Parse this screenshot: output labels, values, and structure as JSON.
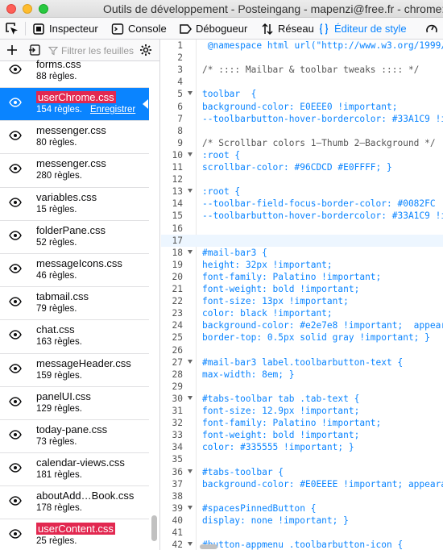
{
  "window": {
    "title": "Outils de développement - Posteingang - mapenzi@free.fr - chrome:/"
  },
  "toolbar": {
    "tabs": [
      {
        "label": "Inspecteur",
        "icon": "inspector-icon"
      },
      {
        "label": "Console",
        "icon": "console-icon"
      },
      {
        "label": "Débogueur",
        "icon": "debugger-icon"
      },
      {
        "label": "Réseau",
        "icon": "network-icon"
      },
      {
        "label": "Éditeur de style",
        "icon": "style-editor-icon",
        "selected": true
      }
    ]
  },
  "sidebar": {
    "filter_placeholder": "Filtrer les feuilles",
    "sheets": [
      {
        "name": "forms.css",
        "rules": "88 règles."
      },
      {
        "name": "userChrome.css",
        "rules": "154 règles.",
        "save": "Enregistrer",
        "selected": true,
        "highlight": true
      },
      {
        "name": "messenger.css",
        "rules": "80 règles."
      },
      {
        "name": "messenger.css",
        "rules": "280 règles."
      },
      {
        "name": "variables.css",
        "rules": "15 règles."
      },
      {
        "name": "folderPane.css",
        "rules": "52 règles."
      },
      {
        "name": "messageIcons.css",
        "rules": "46 règles."
      },
      {
        "name": "tabmail.css",
        "rules": "79 règles."
      },
      {
        "name": "chat.css",
        "rules": "163 règles."
      },
      {
        "name": "messageHeader.css",
        "rules": "159 règles."
      },
      {
        "name": "panelUI.css",
        "rules": "129 règles."
      },
      {
        "name": "today-pane.css",
        "rules": "73 règles."
      },
      {
        "name": "calendar-views.css",
        "rules": "181 règles."
      },
      {
        "name": "aboutAdd…Book.css",
        "rules": "178 règles."
      },
      {
        "name": "userContent.css",
        "rules": "25 règles.",
        "highlight": true
      }
    ]
  },
  "editor": {
    "lines": [
      {
        "n": "1",
        "t": " @namespace html url(\"http://www.w3.org/1999/"
      },
      {
        "n": "2",
        "t": ""
      },
      {
        "n": "3",
        "t": "/* :::: Mailbar & toolbar tweaks :::: */"
      },
      {
        "n": "4",
        "t": ""
      },
      {
        "n": "5",
        "t": "toolbar  {"
      },
      {
        "n": "6",
        "t": "background-color: E0EEE0 !important;"
      },
      {
        "n": "7",
        "t": "--toolbarbutton-hover-bordercolor: #33A1C9 !i"
      },
      {
        "n": "8",
        "t": ""
      },
      {
        "n": "9",
        "t": "/* Scrollbar colors 1—Thumb 2—Background */"
      },
      {
        "n": "10",
        "t": ":root {"
      },
      {
        "n": "11",
        "t": "scrollbar-color: #96CDCD #E0FFFF; }"
      },
      {
        "n": "12",
        "t": ""
      },
      {
        "n": "13",
        "t": ":root {"
      },
      {
        "n": "14",
        "t": "--toolbar-field-focus-border-color: #0082FC !"
      },
      {
        "n": "15",
        "t": "--toolbarbutton-hover-bordercolor: #33A1C9 !i"
      },
      {
        "n": "16",
        "t": ""
      },
      {
        "n": "17",
        "t": ""
      },
      {
        "n": "18",
        "t": "#mail-bar3 {"
      },
      {
        "n": "19",
        "t": "height: 32px !important;"
      },
      {
        "n": "20",
        "t": "font-family: Palatino !important;"
      },
      {
        "n": "21",
        "t": "font-weight: bold !important;"
      },
      {
        "n": "22",
        "t": "font-size: 13px !important;"
      },
      {
        "n": "23",
        "t": "color: black !important;"
      },
      {
        "n": "24",
        "t": "background-color: #e2e7e8 !important;  appear"
      },
      {
        "n": "25",
        "t": "border-top: 0.5px solid gray !important; }"
      },
      {
        "n": "26",
        "t": ""
      },
      {
        "n": "27",
        "t": "#mail-bar3 label.toolbarbutton-text {"
      },
      {
        "n": "28",
        "t": "max-width: 8em; }"
      },
      {
        "n": "29",
        "t": ""
      },
      {
        "n": "30",
        "t": "#tabs-toolbar tab .tab-text {"
      },
      {
        "n": "31",
        "t": "font-size: 12.9px !important;"
      },
      {
        "n": "32",
        "t": "font-family: Palatino !important;"
      },
      {
        "n": "33",
        "t": "font-weight: bold !important;"
      },
      {
        "n": "34",
        "t": "color: #335555 !important; }"
      },
      {
        "n": "35",
        "t": ""
      },
      {
        "n": "36",
        "t": "#tabs-toolbar {"
      },
      {
        "n": "37",
        "t": "background-color: #E0EEEE !important; appeara"
      },
      {
        "n": "38",
        "t": ""
      },
      {
        "n": "39",
        "t": "#spacesPinnedButton {"
      },
      {
        "n": "40",
        "t": "display: none !important; }"
      },
      {
        "n": "41",
        "t": ""
      },
      {
        "n": "42",
        "t": "#button-appmenu .toolbarbutton-icon {"
      }
    ]
  },
  "colors": {
    "accent": "#0a84ff",
    "highlight": "#e22850",
    "value": "#dd00a9"
  }
}
